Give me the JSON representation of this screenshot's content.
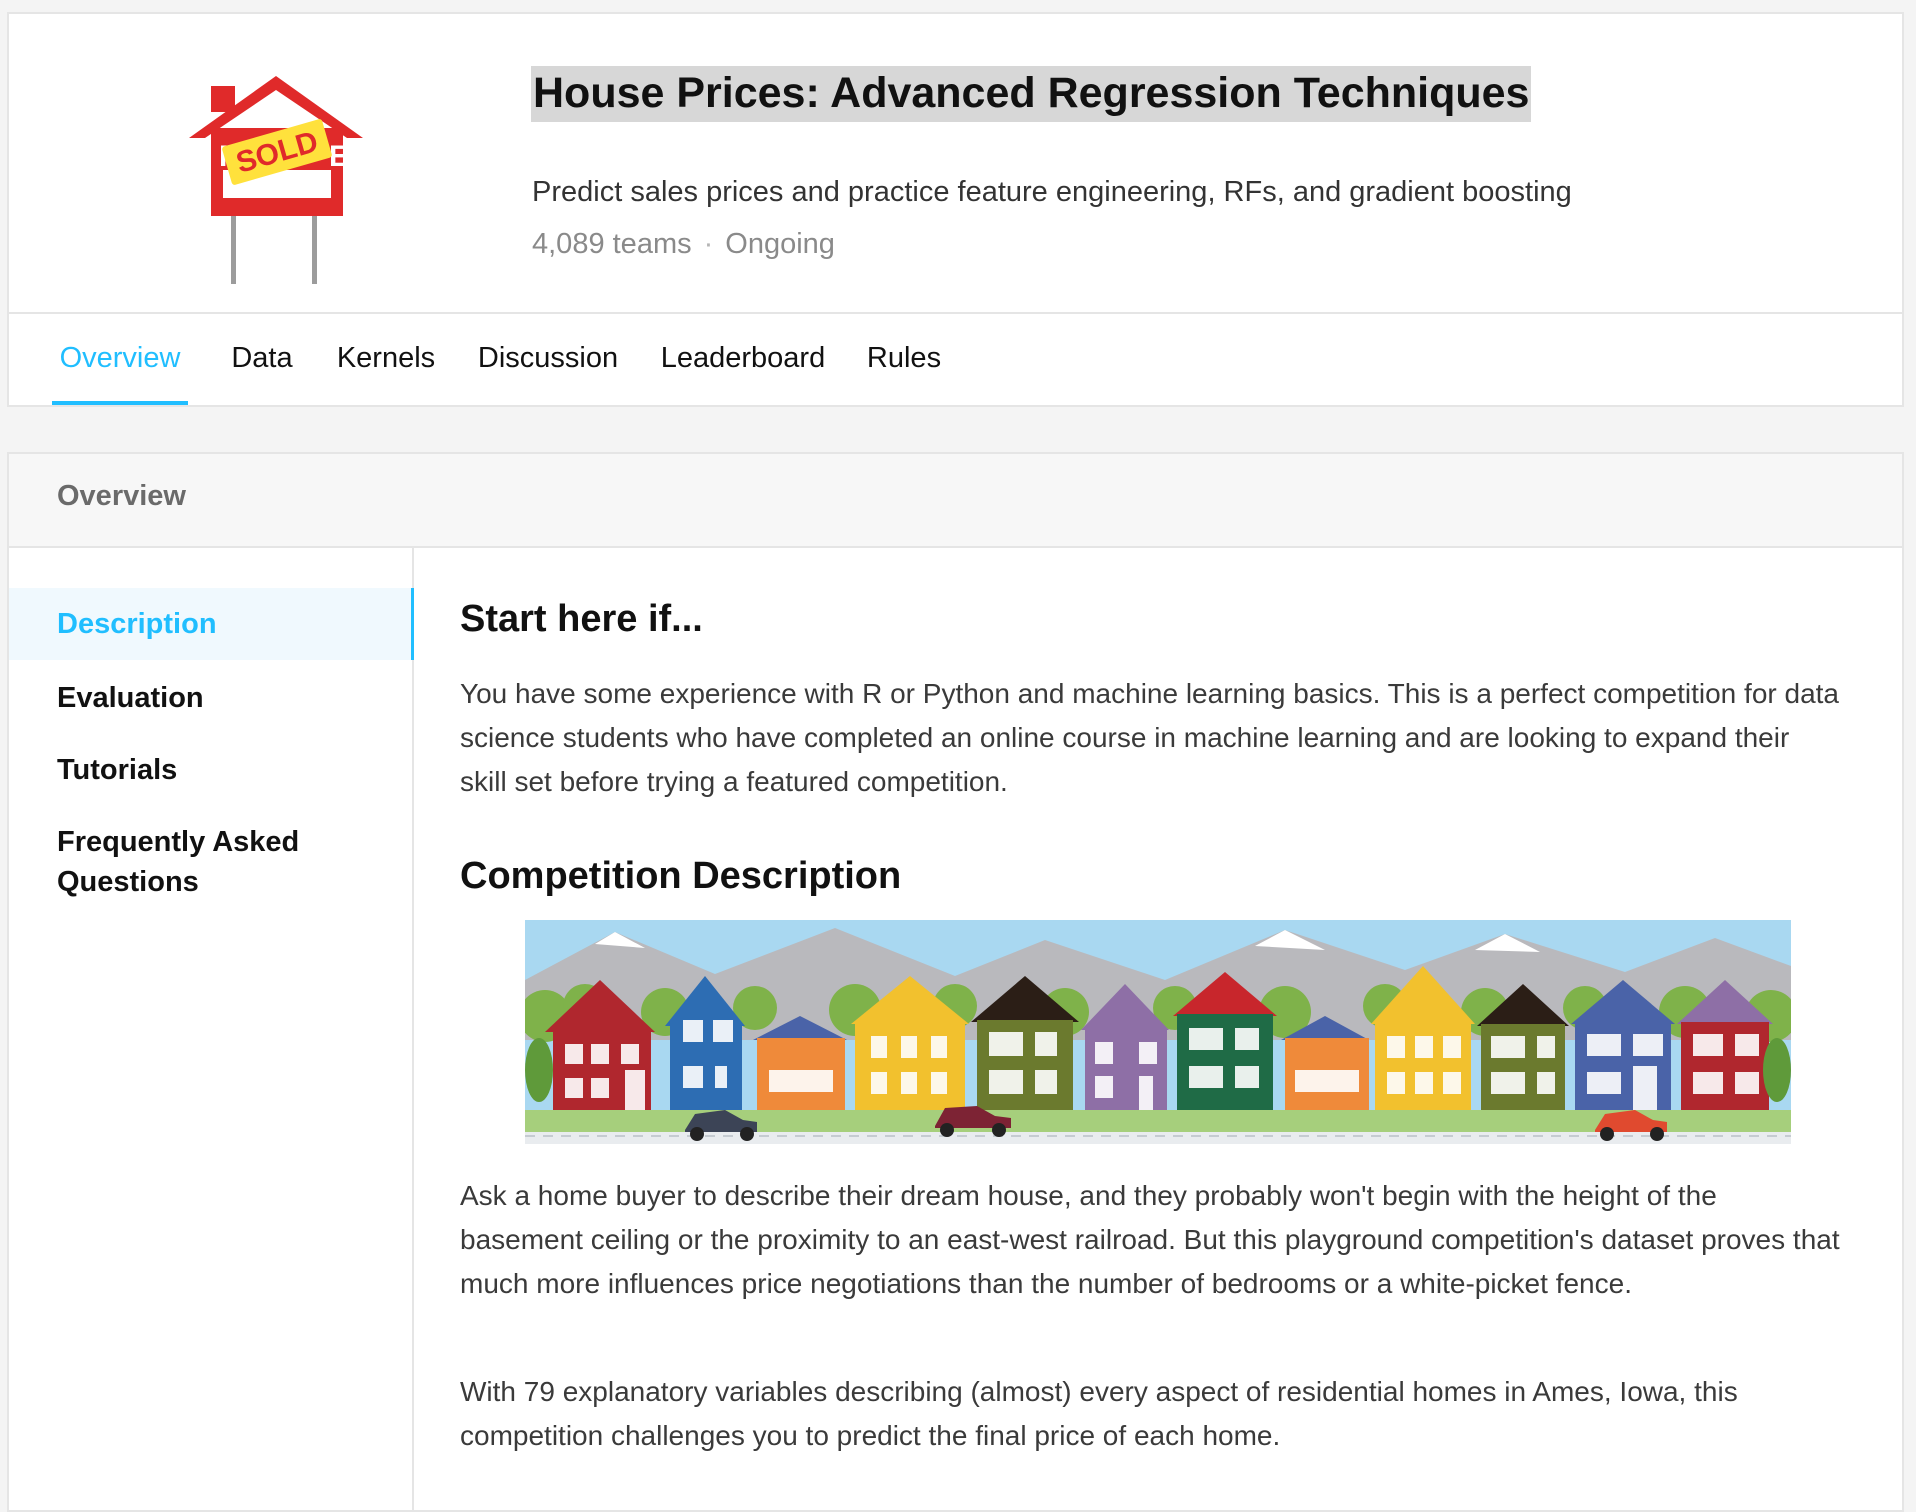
{
  "competition": {
    "title": "House Prices: Advanced Regression Techniques",
    "subtitle": "Predict sales prices and practice feature engineering, RFs, and gradient boosting",
    "teams": "4,089 teams",
    "separator": "·",
    "status": "Ongoing",
    "logo_icon": "for-sale-sign-icon",
    "logo_text": "SOLD"
  },
  "tabs": [
    {
      "label": "Overview",
      "active": true
    },
    {
      "label": "Data"
    },
    {
      "label": "Kernels"
    },
    {
      "label": "Discussion"
    },
    {
      "label": "Leaderboard"
    },
    {
      "label": "Rules"
    }
  ],
  "overview": {
    "header": "Overview",
    "sidenav": [
      {
        "label": "Description",
        "active": true
      },
      {
        "label": "Evaluation"
      },
      {
        "label": "Tutorials"
      },
      {
        "label": "Frequently Asked Questions"
      }
    ],
    "content": {
      "start_heading": "Start here if...",
      "start_text": "You have some experience with R or Python and machine learning basics. This is a perfect competition for data science students who have completed an online course in machine learning and are looking to expand their skill set before trying a featured competition.",
      "desc_heading": "Competition Description",
      "banner_icon": "houses-street-illustration",
      "desc_p1": "Ask a home buyer to describe their dream house, and they probably won't begin with the height of the basement ceiling or the proximity to an east-west railroad. But this playground competition's dataset proves that much more influences price negotiations than the number of bedrooms or a white-picket fence.",
      "desc_p2": "With 79 explanatory variables describing (almost) every aspect of residential homes in Ames, Iowa, this competition challenges you to predict the final price of each home."
    }
  },
  "colors": {
    "accent": "#20beff",
    "sign_red": "#e02a2a",
    "sign_yellow": "#ffe13c"
  }
}
